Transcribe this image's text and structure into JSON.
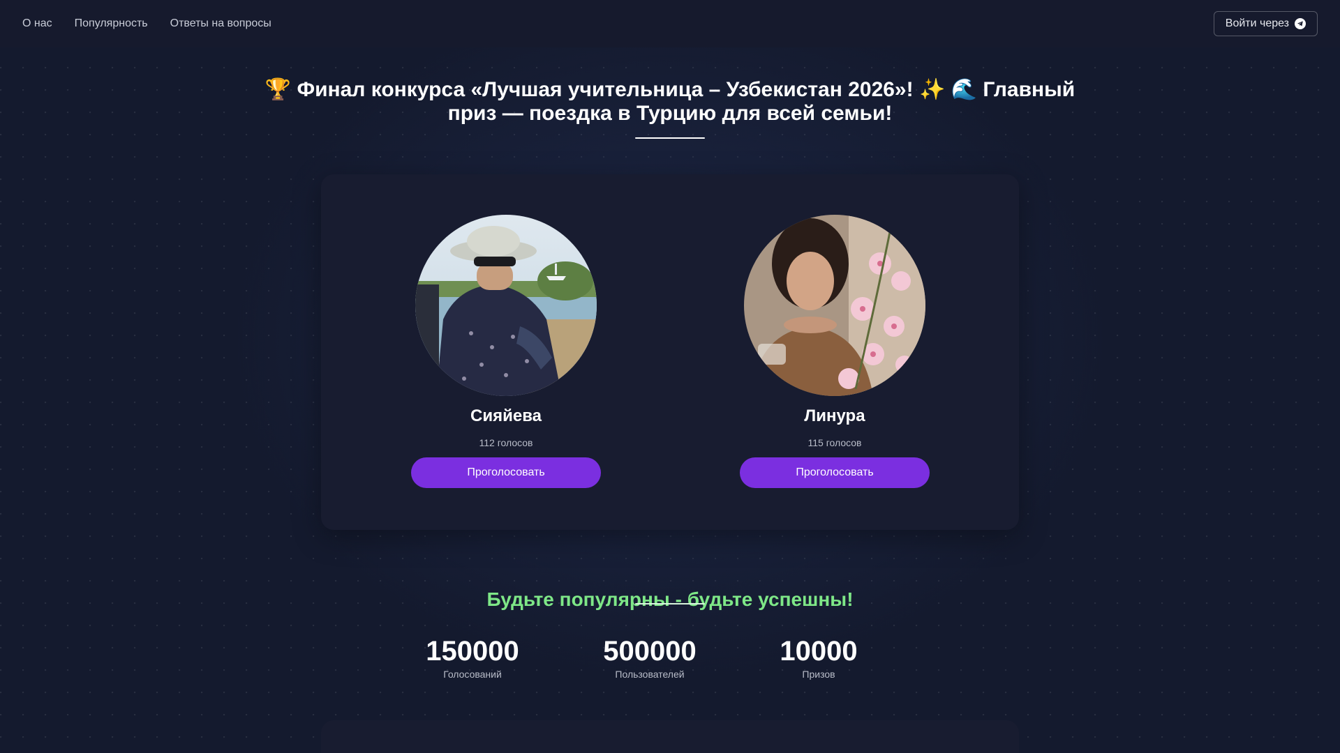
{
  "nav": {
    "links": [
      "О нас",
      "Популярность",
      "Ответы на вопросы"
    ],
    "login_label": "Войти через",
    "login_icon": "telegram-icon"
  },
  "headline": "🏆 Финал конкурса «Лучшая учительница – Узбекистан 2026»! ✨ 🌊 Главный приз — поездка в Турцию для всей семьи!",
  "candidates": [
    {
      "name": "Сияйева",
      "votes": "112 голосов",
      "button": "Проголосовать"
    },
    {
      "name": "Линура",
      "votes": "115 голосов",
      "button": "Проголосовать"
    }
  ],
  "tagline": "Будьте популярны - будьте успешны!",
  "stats": [
    {
      "value": "150000",
      "label": "Голосований"
    },
    {
      "value": "500000",
      "label": "Пользователей"
    },
    {
      "value": "10000",
      "label": "Призов"
    }
  ],
  "colors": {
    "accent": "#7b2fe0",
    "tagline": "#7ee787",
    "background": "#141a2e"
  }
}
